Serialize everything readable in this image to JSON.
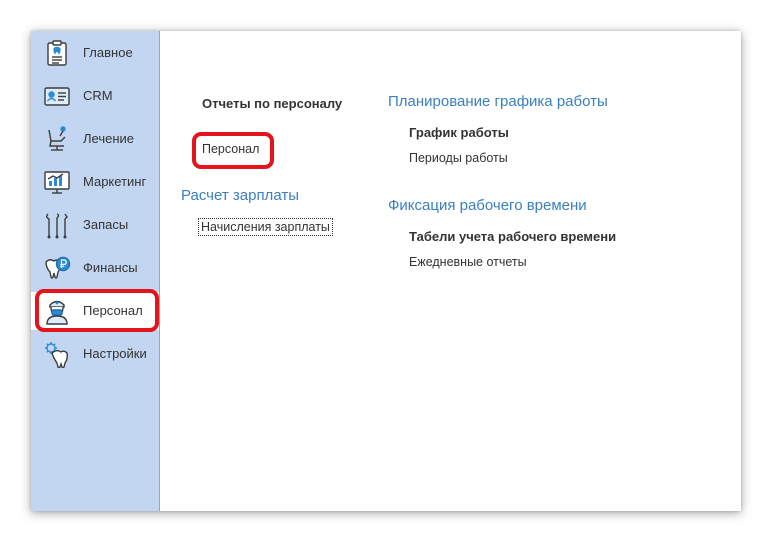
{
  "sidebar": {
    "items": [
      {
        "label": "Главное",
        "icon": "clipboard-tooth-icon"
      },
      {
        "label": "CRM",
        "icon": "contact-card-icon"
      },
      {
        "label": "Лечение",
        "icon": "dental-chair-icon"
      },
      {
        "label": "Маркетинг",
        "icon": "chart-screen-icon"
      },
      {
        "label": "Запасы",
        "icon": "dental-tools-icon"
      },
      {
        "label": "Финансы",
        "icon": "tooth-ruble-icon"
      },
      {
        "label": "Персонал",
        "icon": "doctor-icon",
        "active": true
      },
      {
        "label": "Настройки",
        "icon": "tooth-gear-icon"
      }
    ]
  },
  "content": {
    "reports": {
      "title": "Отчеты по персоналу",
      "items": [
        "Персонал"
      ]
    },
    "payroll": {
      "title": "Расчет зарплаты",
      "items": [
        "Начисления зарплаты"
      ]
    },
    "schedule": {
      "title": "Планирование графика работы",
      "items": [
        "График работы",
        "Периоды работы"
      ]
    },
    "time_tracking": {
      "title": "Фиксация рабочего времени",
      "items": [
        "Табели учета рабочего времени",
        "Ежедневные отчеты"
      ]
    }
  },
  "colors": {
    "sidebar_bg": "#c2d6f1",
    "group_title": "#3a7fc2",
    "highlight": "#e3141b",
    "icon_stroke": "#3c3c3c",
    "icon_accent": "#2b8bd8"
  }
}
